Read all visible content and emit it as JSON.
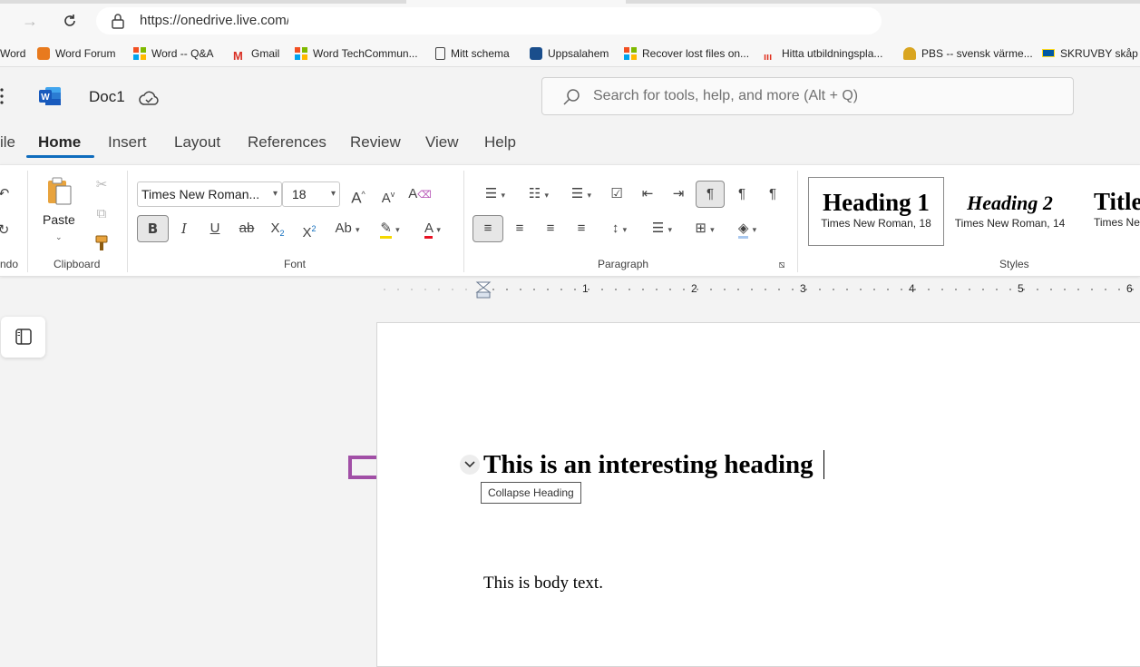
{
  "browser": {
    "url": "https://onedrive.live.com/e",
    "bookmarks": [
      {
        "label": "Word",
        "icon": "word-icon"
      },
      {
        "label": "Word Forum",
        "icon": "forum-icon"
      },
      {
        "label": "Word -- Q&A",
        "icon": "microsoft-logo-icon"
      },
      {
        "label": "Gmail",
        "icon": "gmail-icon"
      },
      {
        "label": "Word TechCommun...",
        "icon": "microsoft-logo-icon"
      },
      {
        "label": "Mitt schema",
        "icon": "document-icon"
      },
      {
        "label": "Uppsalahem",
        "icon": "uppsalahem-icon"
      },
      {
        "label": "Recover lost files on...",
        "icon": "microsoft-logo-icon"
      },
      {
        "label": "Hitta utbildningspla...",
        "icon": "hitta-icon"
      },
      {
        "label": "PBS -- svensk värme...",
        "icon": "pbs-icon"
      },
      {
        "label": "SKRUVBY skåp m",
        "icon": "ikea-icon"
      }
    ]
  },
  "app": {
    "doc_title": "Doc1",
    "search_placeholder": "Search for tools, help, and more (Alt + Q)"
  },
  "tabs": [
    "ile",
    "Home",
    "Insert",
    "Layout",
    "References",
    "Review",
    "View",
    "Help"
  ],
  "ribbon": {
    "undo_label": "ndo",
    "paste_label": "Paste",
    "clipboard_label": "Clipboard",
    "font_name": "Times New Roman...",
    "font_size": "18",
    "font_label": "Font",
    "paragraph_label": "Paragraph",
    "styles_label": "Styles",
    "styles": [
      {
        "name": "Heading 1",
        "sub": "Times New Roman, 18"
      },
      {
        "name": "Heading 2",
        "sub": "Times New Roman, 14"
      },
      {
        "name": "Title",
        "sub": "Times Ne"
      }
    ]
  },
  "ruler": {
    "numbers": [
      "1",
      "2",
      "3",
      "4",
      "5",
      "6"
    ]
  },
  "document": {
    "heading": "This is an interesting heading",
    "tooltip": "Collapse Heading",
    "body": "This is body text."
  },
  "colors": {
    "accent": "#0f6cbd",
    "arrow": "#a14fa6",
    "font_color": "#e81123"
  }
}
